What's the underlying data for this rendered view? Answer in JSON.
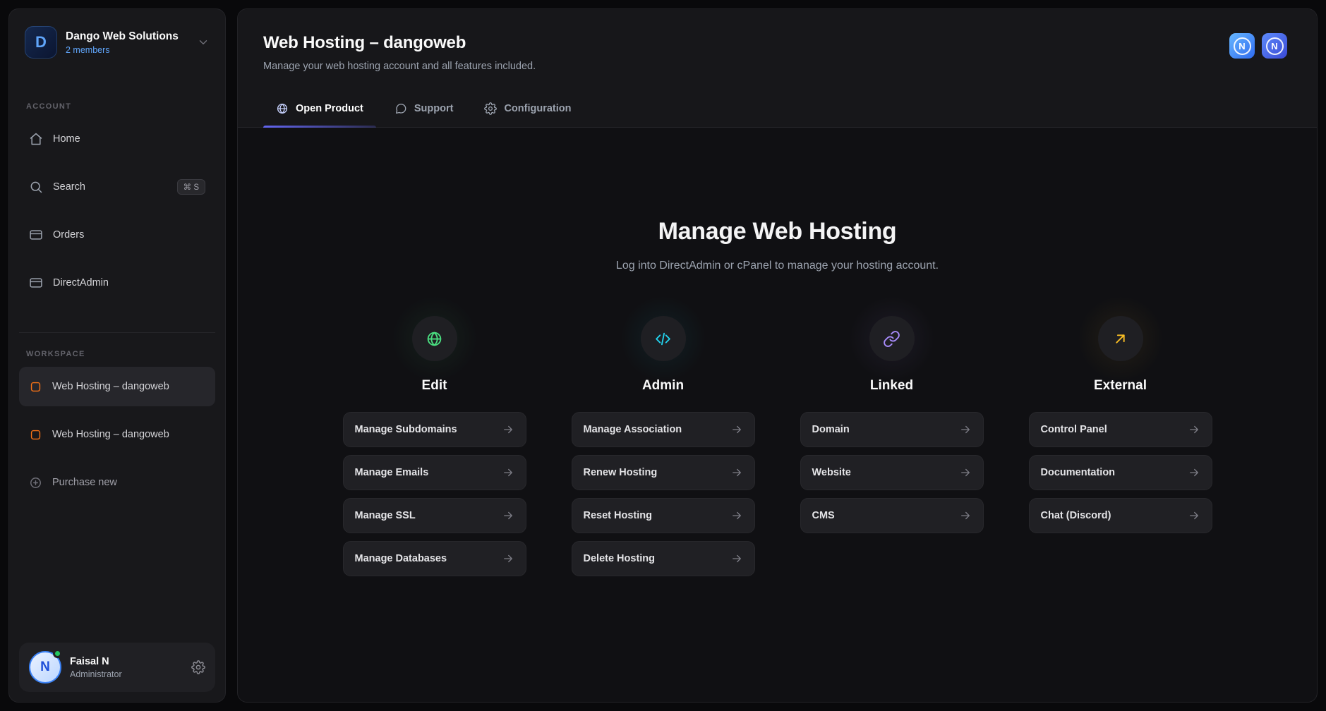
{
  "colors": {
    "accent_indigo": "#6366f1",
    "members_blue": "#60a5fa",
    "workspace_orange": "#f97316",
    "online_green": "#22c55e"
  },
  "sidebar": {
    "workspace_switcher": {
      "logo_letter": "D",
      "name": "Dango Web Solutions",
      "members": "2 members"
    },
    "account_section": {
      "label": "ACCOUNT",
      "items": [
        {
          "label": "Home"
        },
        {
          "label": "Search",
          "shortcut": "⌘ S"
        },
        {
          "label": "Orders"
        },
        {
          "label": "DirectAdmin"
        }
      ]
    },
    "workspace_section": {
      "label": "WORKSPACE",
      "items": [
        {
          "label": "Web Hosting – dangoweb"
        },
        {
          "label": "Web Hosting – dangoweb"
        }
      ],
      "purchase_new": "Purchase new"
    },
    "user": {
      "name": "Faisal N",
      "role": "Administrator",
      "avatar_letter": "N"
    }
  },
  "header": {
    "title": "Web Hosting – dangoweb",
    "subtitle": "Manage your web hosting account and all features included.",
    "app_icon_letter": "N",
    "tabs": [
      {
        "label": "Open Product"
      },
      {
        "label": "Support"
      },
      {
        "label": "Configuration"
      }
    ]
  },
  "main": {
    "heading": "Manage Web Hosting",
    "subheading": "Log into DirectAdmin or cPanel to manage your hosting account.",
    "columns": [
      {
        "title": "Edit",
        "accent": "#4ade80",
        "actions": [
          "Manage Subdomains",
          "Manage Emails",
          "Manage SSL",
          "Manage Databases"
        ]
      },
      {
        "title": "Admin",
        "accent": "#22d3ee",
        "actions": [
          "Manage Association",
          "Renew Hosting",
          "Reset Hosting",
          "Delete Hosting"
        ]
      },
      {
        "title": "Linked",
        "accent": "#a78bfa",
        "actions": [
          "Domain",
          "Website",
          "CMS"
        ]
      },
      {
        "title": "External",
        "accent": "#fbbf24",
        "actions": [
          "Control Panel",
          "Documentation",
          "Chat (Discord)"
        ]
      }
    ]
  }
}
